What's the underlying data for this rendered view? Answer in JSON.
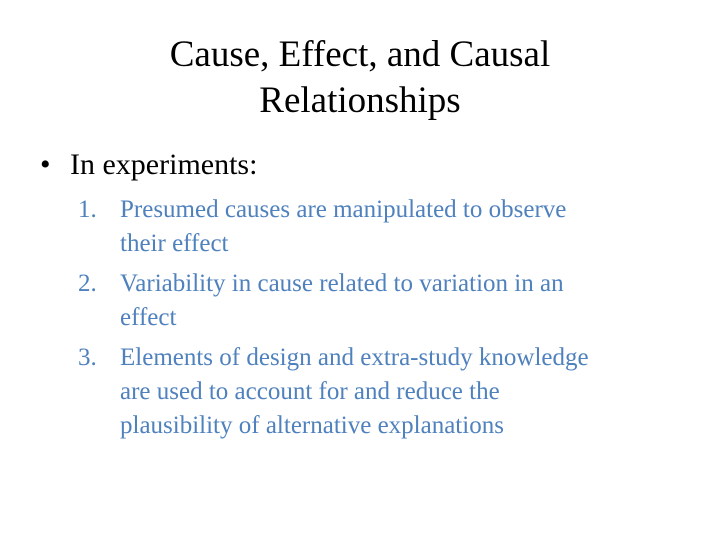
{
  "slide": {
    "title_line1": "Cause, Effect, and Causal",
    "title_line2": "Relationships",
    "bullet_symbol": "•",
    "bullet_text": "In experiments:",
    "items": [
      {
        "number": "1.",
        "line1": "Presumed causes are manipulated to observe",
        "line2": "their effect"
      },
      {
        "number": "2.",
        "line1": "Variability in cause related to variation in an",
        "line2": "effect"
      },
      {
        "number": "3.",
        "line1": "Elements of design and extra-study knowledge",
        "line2": "are used to account for and reduce the",
        "line3": "plausibility of alternative explanations"
      }
    ],
    "colors": {
      "text": "#000000",
      "sublist": "#4f81bd",
      "background": "#ffffff"
    }
  }
}
